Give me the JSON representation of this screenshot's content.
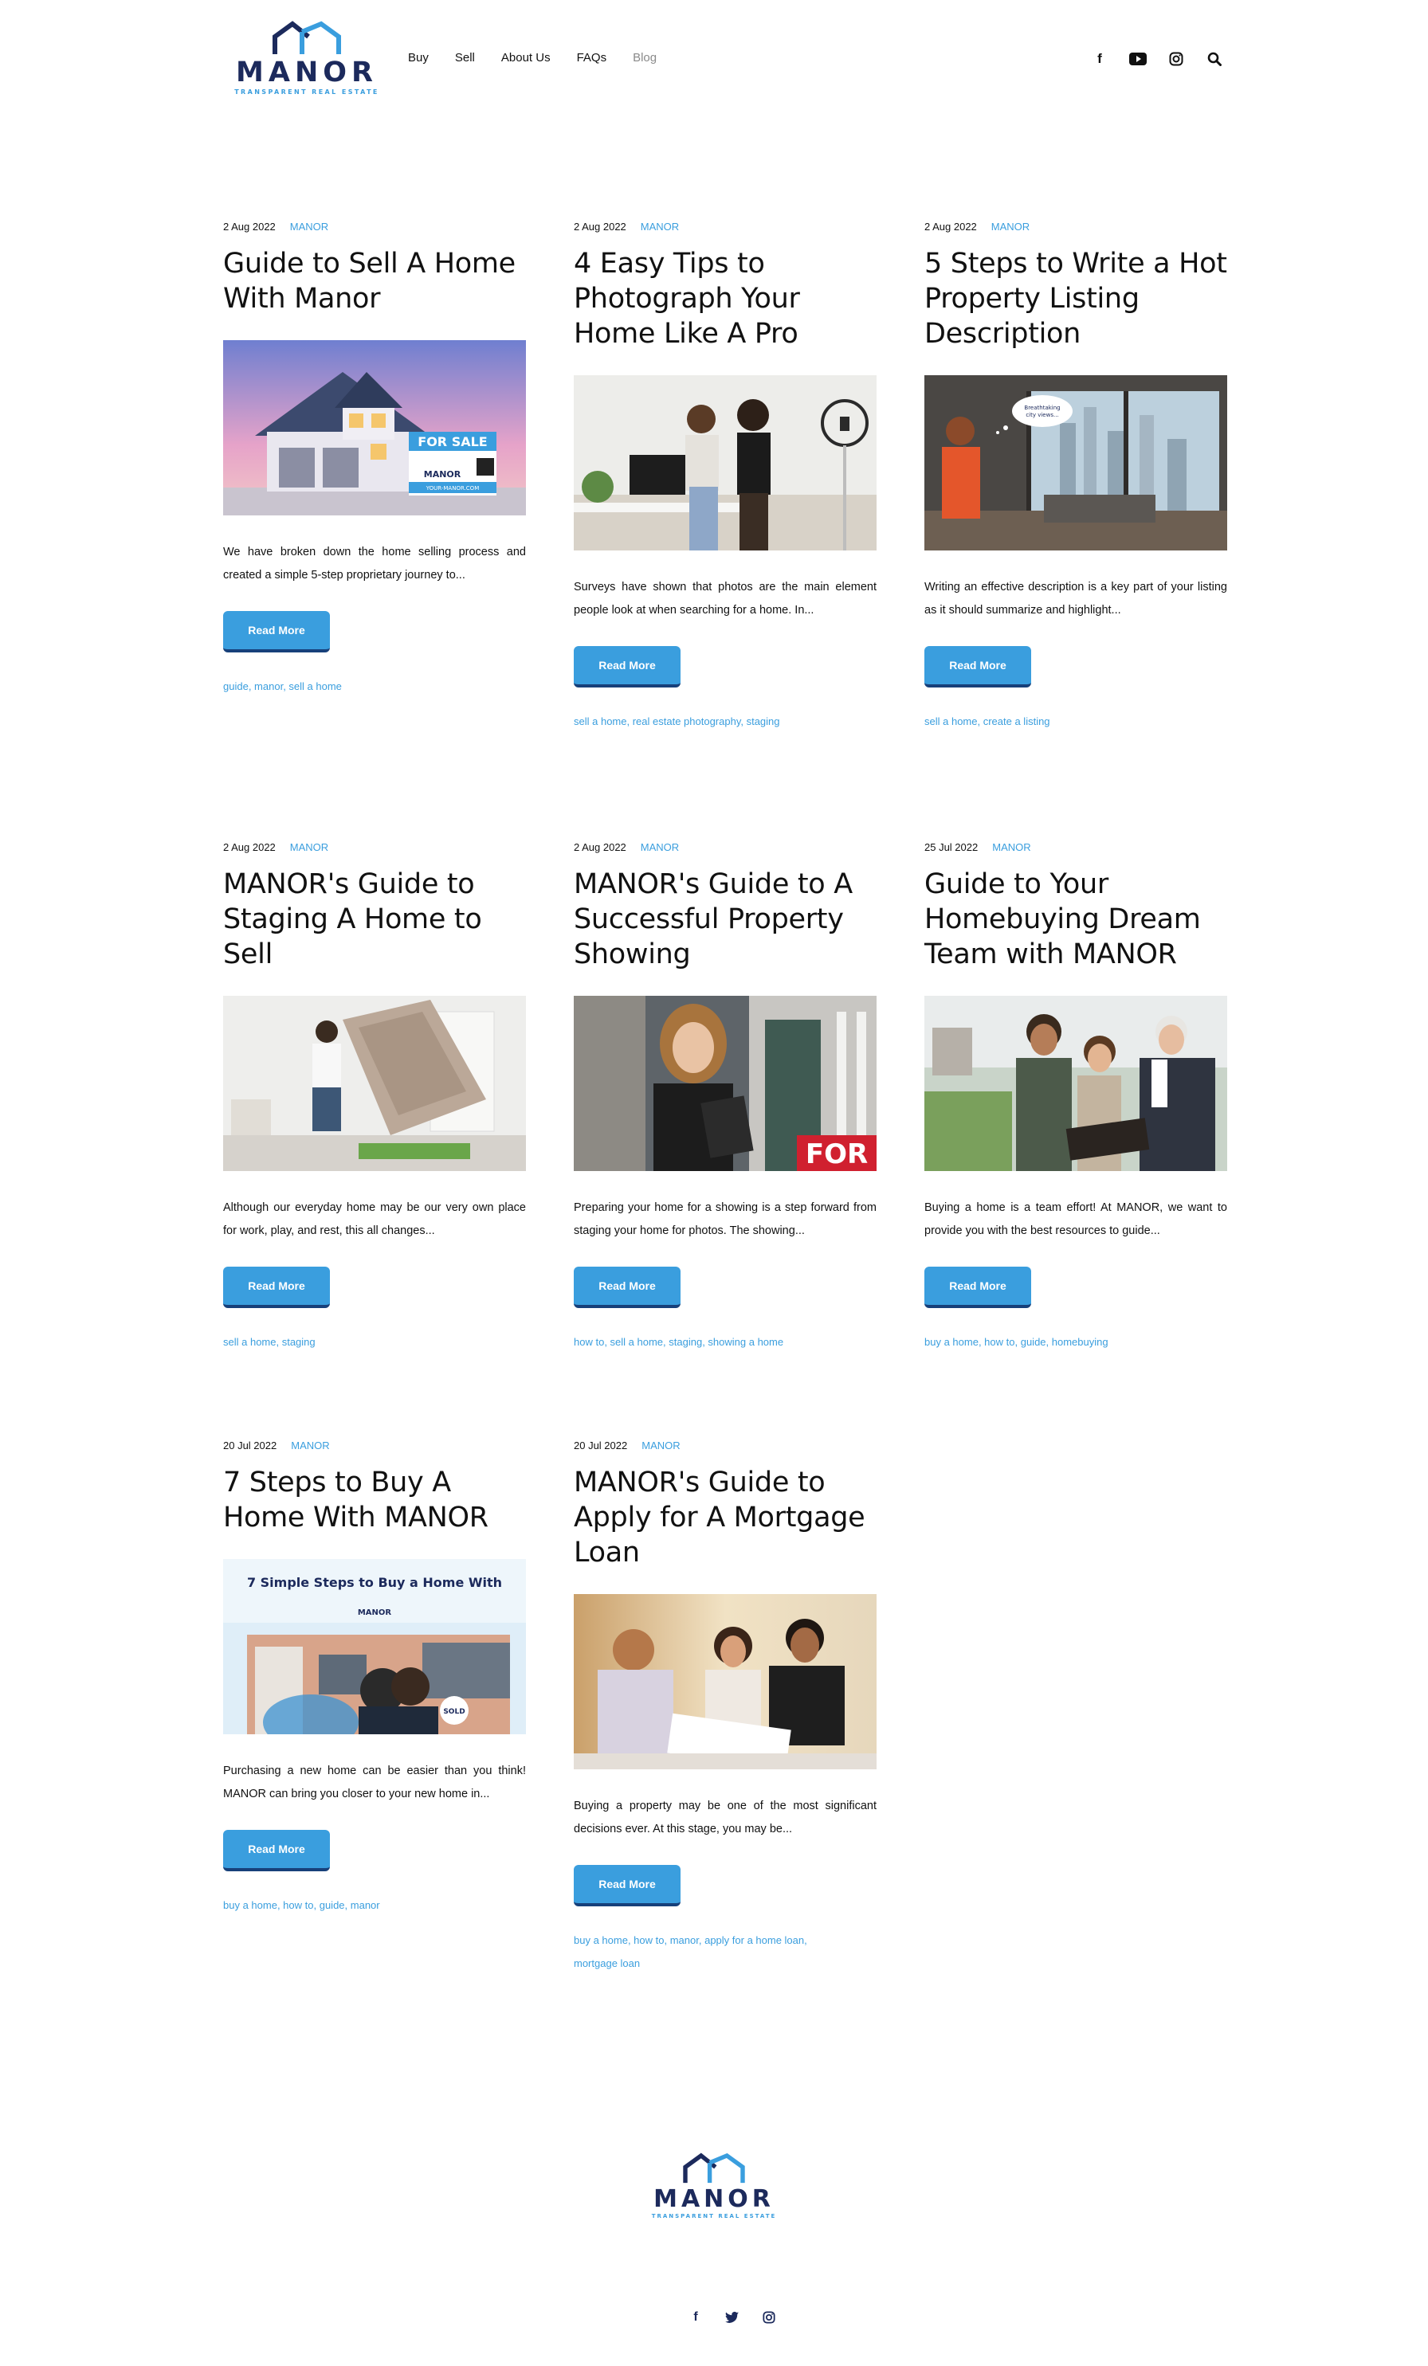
{
  "brand": {
    "name": "MANOR",
    "tagline": "TRANSPARENT REAL ESTATE"
  },
  "nav": [
    "Buy",
    "Sell",
    "About Us",
    "FAQs",
    "Blog"
  ],
  "social_top": [
    {
      "icon": "facebook-icon",
      "glyph": "f"
    },
    {
      "icon": "youtube-icon",
      "glyph": "▶"
    },
    {
      "icon": "instagram-icon",
      "glyph": "◎"
    },
    {
      "icon": "search-icon",
      "glyph": "⚲"
    }
  ],
  "posts": [
    {
      "date": "2 Aug 2022",
      "author": "MANOR",
      "title": "Guide to Sell A Home With Manor",
      "image": "for-sale-house-image",
      "image_text": [
        "FOR SALE",
        "MANOR",
        "YOUR-MANOR.COM"
      ],
      "excerpt": "We have broken down the home selling process and created a simple 5-step proprietary journey to...",
      "button": "Read More",
      "tags": [
        "guide",
        "manor",
        "sell a home"
      ]
    },
    {
      "date": "2 Aug 2022",
      "author": "MANOR",
      "title": "4 Easy Tips to Photograph Your Home Like A Pro",
      "image": "photographers-image",
      "excerpt": "Surveys have shown that photos are the main element people look at when searching for a home. In...",
      "button": "Read More",
      "tags": [
        "sell a home",
        "real estate photography",
        "staging"
      ]
    },
    {
      "date": "2 Aug 2022",
      "author": "MANOR",
      "title": "5 Steps to Write a Hot Property Listing Description",
      "image": "thinking-woman-image",
      "image_text": [
        "Breathtaking city views..."
      ],
      "excerpt": "Writing an effective description is a key part of your listing as it should summarize and highlight...",
      "button": "Read More",
      "tags": [
        "sell a home",
        "create a listing"
      ]
    },
    {
      "date": "2 Aug 2022",
      "author": "MANOR",
      "title": "MANOR's Guide to Staging A Home to Sell",
      "image": "man-lifting-sofa-image",
      "excerpt": "Although our everyday home may be our very own place for work, play, and rest, this all changes...",
      "button": "Read More",
      "tags": [
        "sell a home",
        "staging"
      ]
    },
    {
      "date": "2 Aug 2022",
      "author": "MANOR",
      "title": "MANOR's Guide to A Successful Property Showing",
      "image": "agent-with-folder-image",
      "image_text": [
        "FOR"
      ],
      "excerpt": "Preparing your home for a showing is a step forward from staging your home for photos. The showing...",
      "button": "Read More",
      "tags": [
        "how to",
        "sell a home",
        "staging",
        "showing a home"
      ]
    },
    {
      "date": "25 Jul 2022",
      "author": "MANOR",
      "title": "Guide to Your Homebuying Dream Team with MANOR",
      "image": "couple-with-agent-image",
      "excerpt": "Buying a home is a team effort! At MANOR, we want to provide you with the best resources to guide...",
      "button": "Read More",
      "tags": [
        "buy a home",
        "how to",
        "guide",
        "homebuying"
      ]
    },
    {
      "date": "20 Jul 2022",
      "author": "MANOR",
      "title": "7 Steps to Buy A Home With MANOR",
      "image": "7-steps-image",
      "image_text": [
        "7 Simple Steps to Buy a Home With",
        "MANOR",
        "SOLD"
      ],
      "excerpt": "Purchasing a new home can be easier than you think! MANOR can bring you closer to your new home in...",
      "button": "Read More",
      "tags": [
        "buy a home",
        "how to",
        "guide",
        "manor"
      ]
    },
    {
      "date": "20 Jul 2022",
      "author": "MANOR",
      "title": "MANOR's Guide to Apply for A Mortgage Loan",
      "image": "mortgage-meeting-image",
      "excerpt": "Buying a property may be one of the most significant decisions ever. At this stage, you may be...",
      "button": "Read More",
      "tags": [
        "buy a home",
        "how to",
        "manor",
        "apply for a home loan",
        "mortgage loan"
      ]
    }
  ],
  "social_bottom": [
    {
      "icon": "facebook-icon",
      "glyph": "f"
    },
    {
      "icon": "twitter-icon",
      "glyph": "t"
    },
    {
      "icon": "instagram-icon",
      "glyph": "◎"
    }
  ],
  "colors": {
    "accent": "#3a9ede",
    "brand_dark": "#1c2a5c",
    "button_shadow": "#17407a"
  }
}
